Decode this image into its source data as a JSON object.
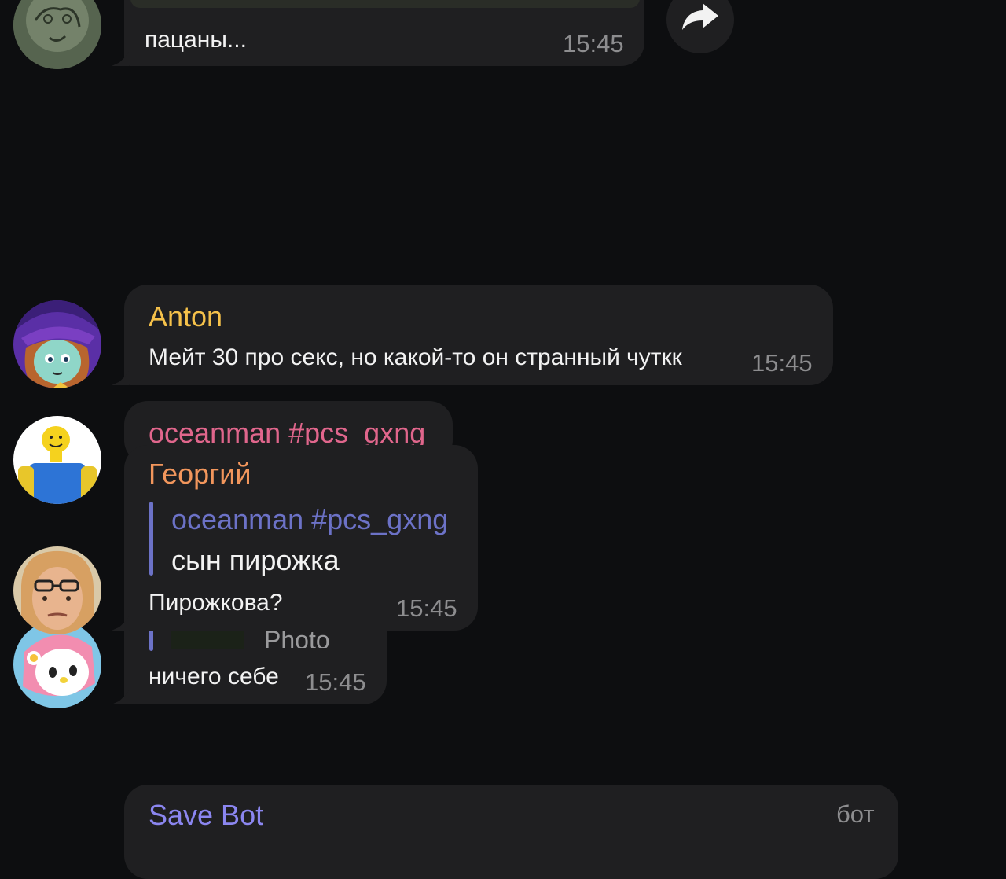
{
  "messages": {
    "top": {
      "text": "пацаны...",
      "time": "15:45"
    },
    "anton": {
      "sender": "Anton",
      "text": "Мейт 30 про секс, но какой-то он странный чуткк",
      "time": "15:45"
    },
    "oceanman_partial": {
      "sender": "oceanman #pcs_gxng"
    },
    "georgiy": {
      "sender": "Георгий",
      "reply_sender": "oceanman #pcs_gxng",
      "reply_text": "сын пирожка",
      "text": "Пирожкова?",
      "time": "15:45"
    },
    "hidden_reply": {
      "reply_text": "Photo",
      "text": "ничего себе",
      "time": "15:45"
    },
    "bottom": {
      "sender": "Save Bot",
      "badge": "бот"
    }
  },
  "colors": {
    "background": "#0d0e10",
    "bubble": "#1f1f21",
    "anton_name": "#f5c14a",
    "oceanman_name": "#e0668c",
    "georgiy_name": "#f2965c",
    "reply_name": "#6c72c7",
    "bot_name": "#8b86f0"
  },
  "icons": [
    "forward-icon"
  ]
}
